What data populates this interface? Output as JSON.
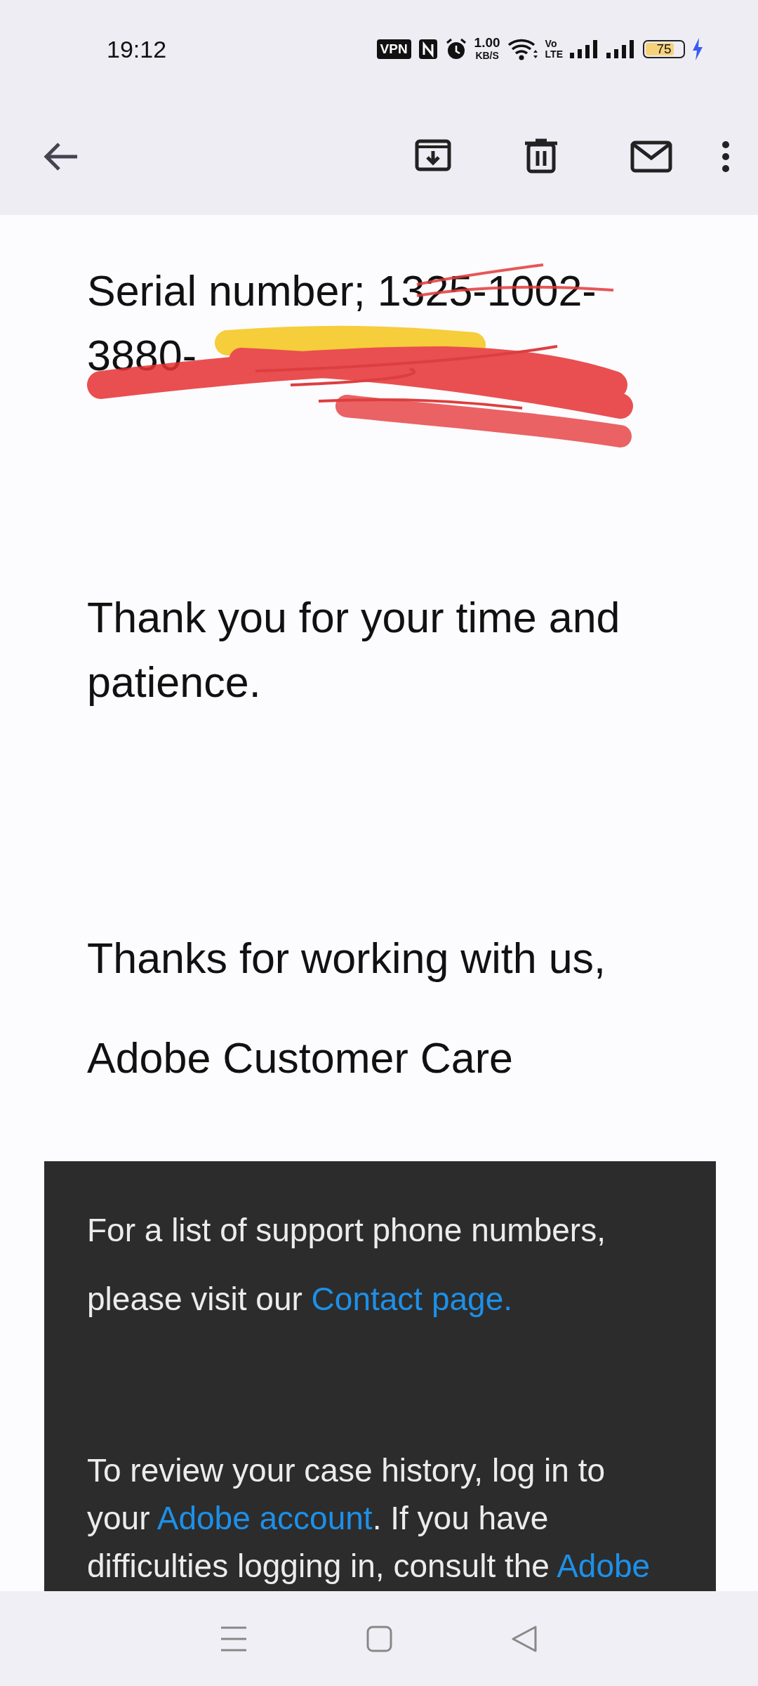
{
  "status_bar": {
    "time": "19:12",
    "vpn": "VPN",
    "speed_value": "1.00",
    "speed_unit": "KB/S",
    "volte_top": "Vo",
    "volte_bottom": "LTE",
    "battery": "75",
    "charging": true
  },
  "toolbar": {
    "actions": [
      {
        "kind": "archive"
      },
      {
        "kind": "delete"
      },
      {
        "kind": "mail"
      },
      {
        "kind": "more"
      }
    ]
  },
  "message": {
    "paragraphs": [
      {
        "kind": "serial",
        "lines": [
          "Serial number; 1325-1002-",
          "3880-"
        ],
        "redacted": true
      },
      {
        "kind": "text",
        "lines": [
          "Thank you for your time and",
          "patience."
        ]
      },
      {
        "kind": "text",
        "lines": [
          "Thanks for working with us,"
        ]
      },
      {
        "kind": "text",
        "lines": [
          "Adobe Customer Care"
        ]
      }
    ]
  },
  "footer": {
    "paragraphs": [
      {
        "lines": [
          [
            {
              "text": "For a list of support phone numbers,"
            }
          ],
          [
            {
              "text": "please visit our "
            },
            {
              "text": "Contact page.",
              "link": true
            }
          ]
        ]
      },
      {
        "lines": [
          [
            {
              "text": "To review your case history, log in to"
            }
          ],
          [
            {
              "text": "your "
            },
            {
              "text": "Adobe account",
              "link": true
            },
            {
              "text": ". If you have"
            }
          ],
          [
            {
              "text": "difficulties logging in, consult the "
            },
            {
              "text": "Adobe",
              "link": true
            }
          ]
        ]
      }
    ]
  }
}
